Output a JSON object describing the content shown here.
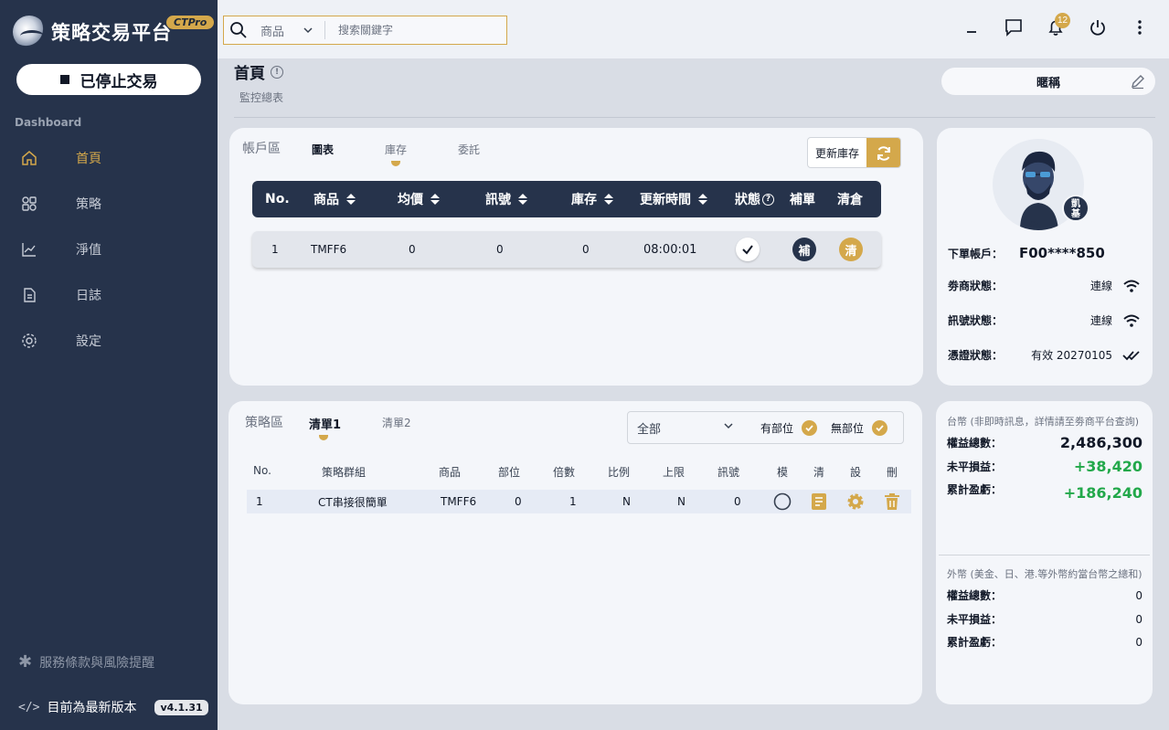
{
  "app": {
    "title": "策略交易平台",
    "badge": "CTPro"
  },
  "sidebar": {
    "stop_button": "已停止交易",
    "section_label": "Dashboard",
    "items": [
      {
        "label": "首頁",
        "icon": "home-icon",
        "active": true
      },
      {
        "label": "策略",
        "icon": "strategy-icon",
        "active": false
      },
      {
        "label": "淨值",
        "icon": "chart-icon",
        "active": false
      },
      {
        "label": "日誌",
        "icon": "document-icon",
        "active": false
      },
      {
        "label": "設定",
        "icon": "gear-icon",
        "active": false
      }
    ],
    "terms": "服務條款與風險提醒",
    "version_text": "目前為最新版本",
    "version": "v4.1.31"
  },
  "search": {
    "category": "商品",
    "placeholder": "搜索關鍵字"
  },
  "topbar": {
    "notification_count": "12"
  },
  "header": {
    "title": "首頁",
    "subtitle": "監控總表",
    "alias": "暱稱"
  },
  "account": {
    "label": "帳戶區",
    "tabs": [
      "圖表",
      "庫存",
      "委託"
    ],
    "update_button": "更新庫存",
    "columns": [
      "No.",
      "商品",
      "均價",
      "訊號",
      "庫存",
      "更新時間",
      "狀態",
      "補單",
      "清倉"
    ],
    "rows": [
      {
        "no": "1",
        "product": "TMFF6",
        "avg_price": "0",
        "signal": "0",
        "inventory": "0",
        "time": "08:00:01",
        "fill": "補",
        "clear": "清"
      }
    ]
  },
  "strategy": {
    "label": "策略區",
    "tabs": [
      "清單1",
      "清單2"
    ],
    "filter": "全部",
    "checks": [
      "有部位",
      "無部位"
    ],
    "columns": [
      "No.",
      "策略群組",
      "商品",
      "部位",
      "倍數",
      "比例",
      "上限",
      "訊號",
      "模",
      "清",
      "設",
      "刪"
    ],
    "rows": [
      {
        "no": "1",
        "group": "CT串接很簡單",
        "product": "TMFF6",
        "position": "0",
        "multiplier": "1",
        "ratio": "N",
        "limit": "N",
        "signal": "0"
      }
    ]
  },
  "profile": {
    "avatar_badge_1": "凱",
    "avatar_badge_2": "基",
    "account_label": "下單帳戶：",
    "account": "F00****850",
    "broker_label": "劵商狀態：",
    "broker_status": "連線",
    "signal_label": "訊號狀態：",
    "signal_status": "連線",
    "cert_label": "憑證狀態：",
    "cert_status": "有效 20270105"
  },
  "balance": {
    "twd_header": "台幣",
    "twd_note": "(非即時訊息，詳情請至劵商平台查詢)",
    "equity_label": "權益總數：",
    "equity": "2,486,300",
    "unrealized_label": "未平損益：",
    "unrealized": "+38,420",
    "realized_label": "累計盈虧：",
    "realized": "+186,240",
    "fx_header": "外幣",
    "fx_note": "(美金、日、港.等外幣約當台幣之總和)",
    "fx_equity": "0",
    "fx_unrealized": "0",
    "fx_realized": "0"
  },
  "colors": {
    "accent": "#d4a84b",
    "sidebar": "#26334b",
    "positive": "#22a84a"
  }
}
